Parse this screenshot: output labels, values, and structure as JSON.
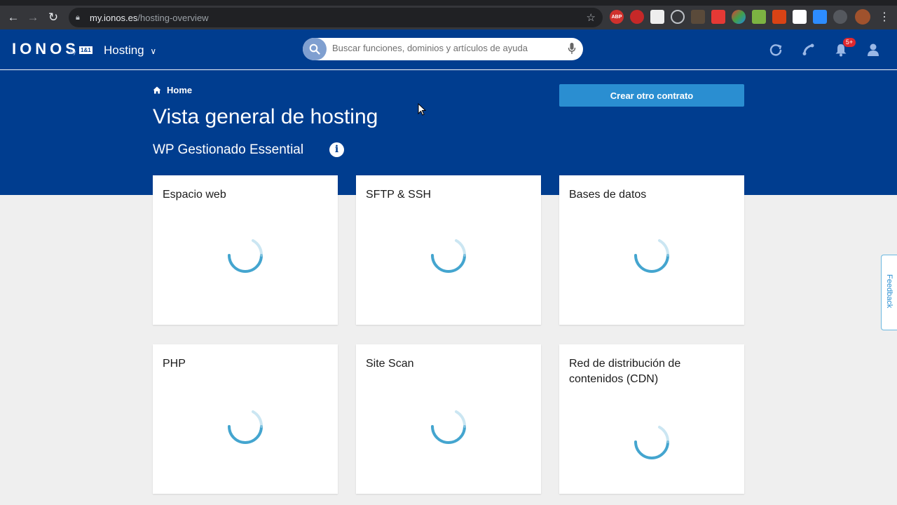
{
  "browser": {
    "url_host": "my.ionos.es",
    "url_path": "/hosting-overview"
  },
  "header": {
    "logo": "IONOS",
    "logo_by": "by",
    "logo_partner": "1&1",
    "product": "Hosting",
    "search_placeholder": "Buscar funciones, dominios y artículos de ayuda",
    "notification_badge": "5+"
  },
  "hero": {
    "breadcrumb": "Home",
    "title": "Vista general de hosting",
    "subtitle": "WP Gestionado Essential",
    "info": "i",
    "create_button": "Crear otro contrato"
  },
  "cards": [
    {
      "title": "Espacio web"
    },
    {
      "title": "SFTP & SSH"
    },
    {
      "title": "Bases de datos"
    },
    {
      "title": "PHP"
    },
    {
      "title": "Site Scan"
    },
    {
      "title": "Red de distribución de contenidos (CDN)"
    }
  ],
  "feedback": "Feedback",
  "colors": {
    "brand_blue": "#003d8f",
    "button_blue": "#2a8ed1",
    "spinner": "#3aa0cc"
  }
}
